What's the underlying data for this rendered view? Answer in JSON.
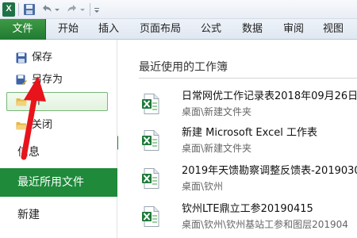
{
  "ribbon": {
    "tabs": [
      {
        "label": "文件"
      },
      {
        "label": "开始"
      },
      {
        "label": "插入"
      },
      {
        "label": "页面布局"
      },
      {
        "label": "公式"
      },
      {
        "label": "数据"
      },
      {
        "label": "审阅"
      },
      {
        "label": "视图"
      }
    ]
  },
  "qat": {
    "logo": "X"
  },
  "backstage": {
    "menu": [
      {
        "label": "保存",
        "icon": "save-icon"
      },
      {
        "label": "另存为",
        "icon": "save-as-icon"
      },
      {
        "label": "开",
        "icon": "open-folder-icon"
      },
      {
        "label": "关闭",
        "icon": "close-folder-icon"
      }
    ],
    "sections": {
      "info": "信息",
      "recent": "最近所用文件",
      "new": "新建"
    }
  },
  "recent": {
    "heading": "最近使用的工作簿",
    "files": [
      {
        "name": "日常网优工作记录表2018年09月26日",
        "path": "桌面\\新建文件夹"
      },
      {
        "name": "新建 Microsoft Excel 工作表",
        "path": "桌面\\新建文件夹"
      },
      {
        "name": "2019年天馈勘察调整反馈表-20190305",
        "path": "桌面\\钦州"
      },
      {
        "name": "钦州LTE鼎立工参20190415",
        "path": "桌面\\钦州\\钦州基站工参和图层201904"
      }
    ]
  },
  "colors": {
    "accent": "#1e8a3a",
    "file_tab": "#217a32",
    "annotation": "#e8141c"
  }
}
